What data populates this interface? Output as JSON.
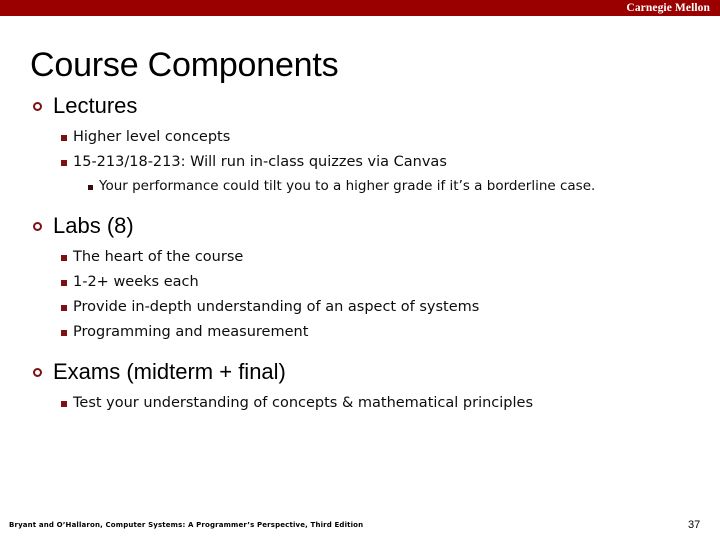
{
  "banner": {
    "institution": "Carnegie Mellon",
    "color": "#9b0000"
  },
  "slide": {
    "title": "Course Components",
    "page_number": "37",
    "accent_color": "#7b1113"
  },
  "bullets": [
    {
      "level": 1,
      "icon": "hollow-circle-bullet",
      "text": "Lectures"
    },
    {
      "level": 2,
      "icon": "square-bullet",
      "text": "Higher level concepts"
    },
    {
      "level": 2,
      "icon": "square-bullet",
      "text": "15-213/18-213: Will run in-class quizzes via Canvas"
    },
    {
      "level": 3,
      "icon": "small-square-bullet",
      "text": "Your performance could tilt you to a higher grade if it’s a borderline case."
    },
    {
      "level": 1,
      "icon": "hollow-circle-bullet",
      "text": "Labs (8)"
    },
    {
      "level": 2,
      "icon": "square-bullet",
      "text": "The heart of the course"
    },
    {
      "level": 2,
      "icon": "square-bullet",
      "text": "1-2+ weeks each"
    },
    {
      "level": 2,
      "icon": "square-bullet",
      "text": "Provide in-depth understanding of an aspect of systems"
    },
    {
      "level": 2,
      "icon": "square-bullet",
      "text": "Programming and measurement"
    },
    {
      "level": 1,
      "icon": "hollow-circle-bullet",
      "text": "Exams (midterm + final)"
    },
    {
      "level": 2,
      "icon": "square-bullet",
      "text": "Test your understanding of concepts & mathematical principles"
    }
  ],
  "footer": {
    "citation": "Bryant and O’Hallaron, Computer Systems: A Programmer’s Perspective, Third Edition"
  }
}
